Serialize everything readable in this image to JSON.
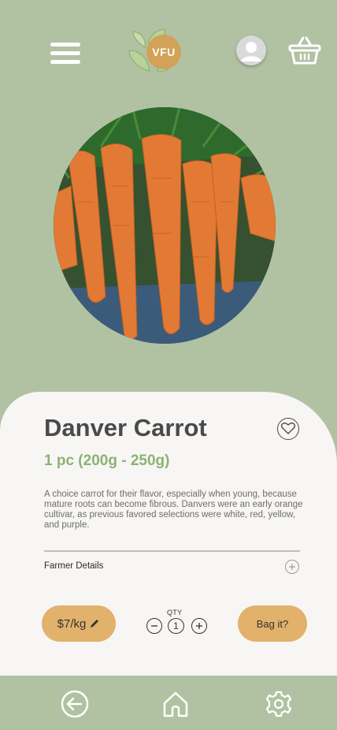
{
  "header": {
    "logo_text": "VFU",
    "menu_icon": "hamburger-menu-icon",
    "profile_icon": "user-avatar-icon",
    "cart_icon": "shopping-basket-icon"
  },
  "product": {
    "name": "Danver Carrot",
    "quantity_weight": "1 pc (200g - 250g)",
    "description": "A choice carrot for their flavor, especially when young, because mature roots can become fibrous. Danvers were an early orange cultivar, as previous favored selections were white, red, yellow, and purple.",
    "image_alt": "carrots",
    "favorite_icon": "heart-icon"
  },
  "farmer": {
    "label": "Farmer Details",
    "expand_icon": "plus-circle-icon"
  },
  "purchase": {
    "price": "$7/kg",
    "qty_label": "QTY",
    "qty_value": "1",
    "bag_label": "Bag it?"
  },
  "nav": {
    "back_icon": "back-arrow-icon",
    "home_icon": "home-icon",
    "settings_icon": "gear-icon"
  },
  "colors": {
    "background": "#b1c2a3",
    "card": "#f7f6f4",
    "accent": "#e2b16b",
    "subtitle_green": "#8cb372",
    "logo_gold": "#d1a257"
  }
}
